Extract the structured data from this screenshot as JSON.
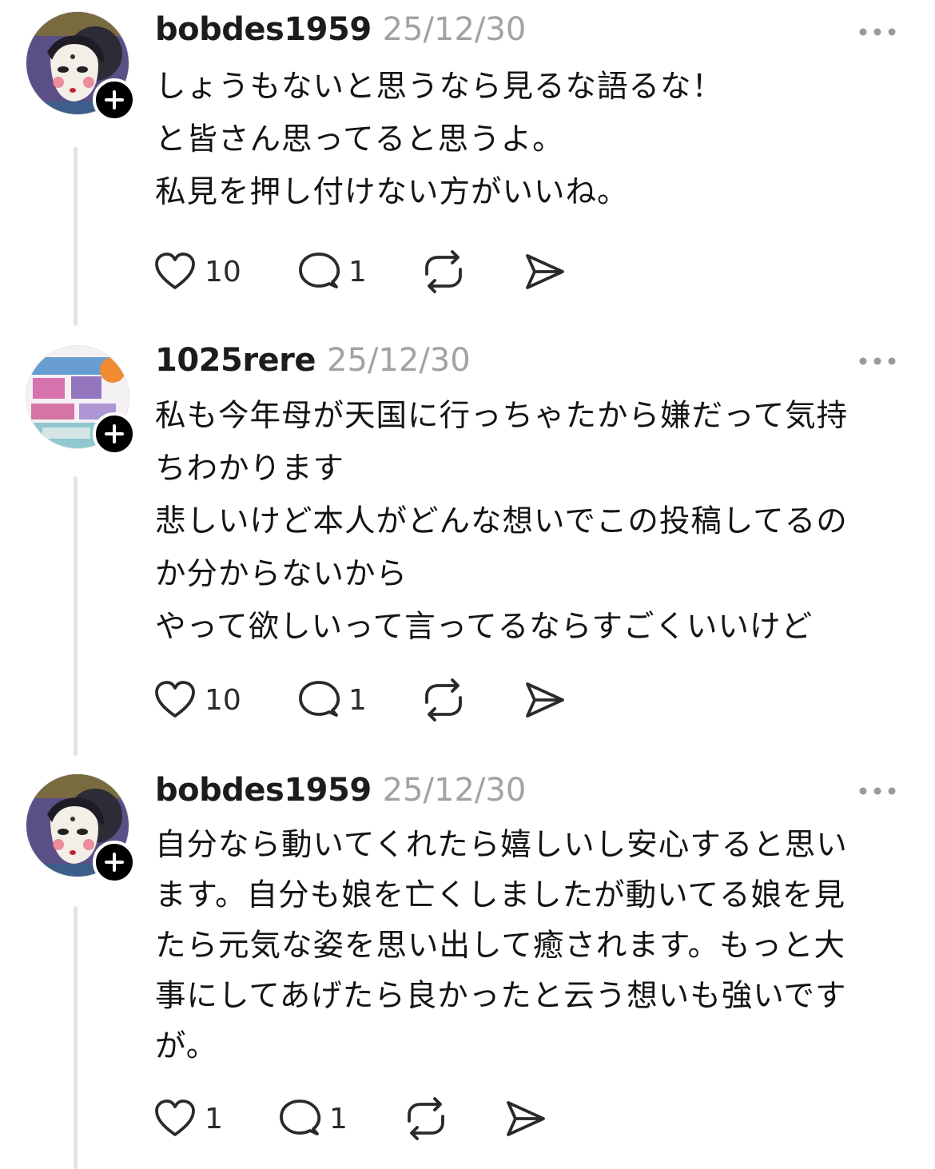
{
  "posts": [
    {
      "username": "bobdes1959",
      "date": "25/12/30",
      "avatar": "illustrated-face-avatar",
      "lines": [
        "しょうもないと思うなら見るな語るな！",
        "と皆さん思ってると思うよ。",
        "私見を押し付けない方がいいね。"
      ],
      "likes": "10",
      "replies": "1"
    },
    {
      "username": "1025rere",
      "date": "25/12/30",
      "avatar": "colorful-sign-avatar",
      "lines": [
        "私も今年母が天国に行っちゃたから嫌だって気持",
        "ちわかります",
        "悲しいけど本人がどんな想いでこの投稿してるの",
        "か分からないから",
        "やって欲しいって言ってるならすごくいいけど"
      ],
      "likes": "10",
      "replies": "1"
    },
    {
      "username": "bobdes1959",
      "date": "25/12/30",
      "avatar": "illustrated-face-avatar",
      "lines": [
        "自分なら動いてくれたら嬉しいし安心すると思い",
        "ます。自分も娘を亡くしましたが動いてる娘を見",
        "たら元気な姿を思い出して癒されます。もっと大",
        "事にしてあげたら良かったと云う想いも強いです",
        "が。"
      ],
      "likes": "1",
      "replies": "1"
    }
  ],
  "icons": {
    "like": "heart-icon",
    "reply": "comment-icon",
    "repost": "repost-icon",
    "share": "send-icon",
    "more": "more-options-icon",
    "follow": "plus-icon"
  },
  "colors": {
    "text": "#141414",
    "muted": "#a2a2a2",
    "thread_line": "#e3e3e3"
  }
}
